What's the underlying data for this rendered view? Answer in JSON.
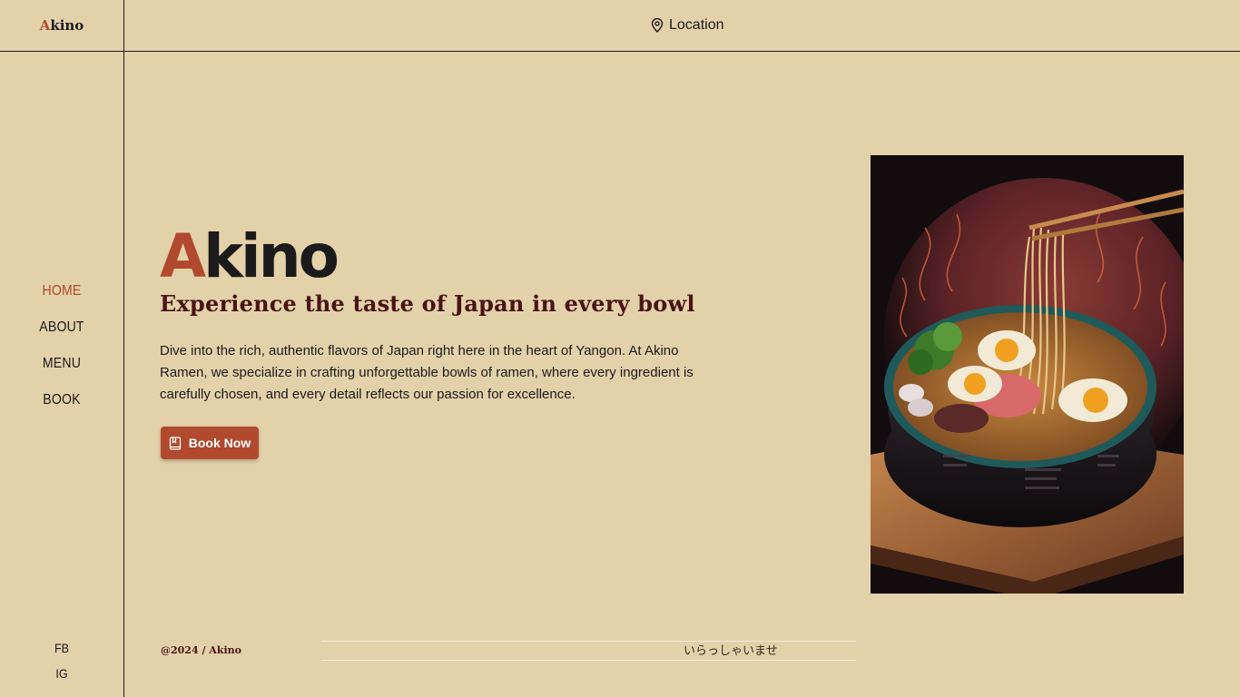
{
  "header": {
    "logo_first": "A",
    "logo_rest": "kino",
    "location_label": "Location",
    "location_icon": "map-pin-icon"
  },
  "nav": {
    "items": [
      {
        "label": "HOME",
        "active": true
      },
      {
        "label": "ABOUT",
        "active": false
      },
      {
        "label": "MENU",
        "active": false
      },
      {
        "label": "BOOK",
        "active": false
      }
    ]
  },
  "social": {
    "items": [
      {
        "label": "FB"
      },
      {
        "label": "IG"
      }
    ]
  },
  "hero": {
    "brand_first": "A",
    "brand_rest": "kino",
    "headline": "Experience the taste of Japan in every bowl",
    "description": "Dive into the rich, authentic flavors of Japan right here in the heart of Yangon. At Akino Ramen, we specialize in crafting unforgettable bowls of ramen, where every ingredient is carefully chosen, and every detail reflects our passion for excellence.",
    "cta_label": "Book Now",
    "cta_icon": "book-icon"
  },
  "footer": {
    "copyright": "@2024 / Akino",
    "marquee_text": "いらっしゃいませ"
  },
  "colors": {
    "background": "#e3d1aa",
    "accent": "#b0492d",
    "headline": "#4a1414",
    "text": "#1b1b1b"
  }
}
